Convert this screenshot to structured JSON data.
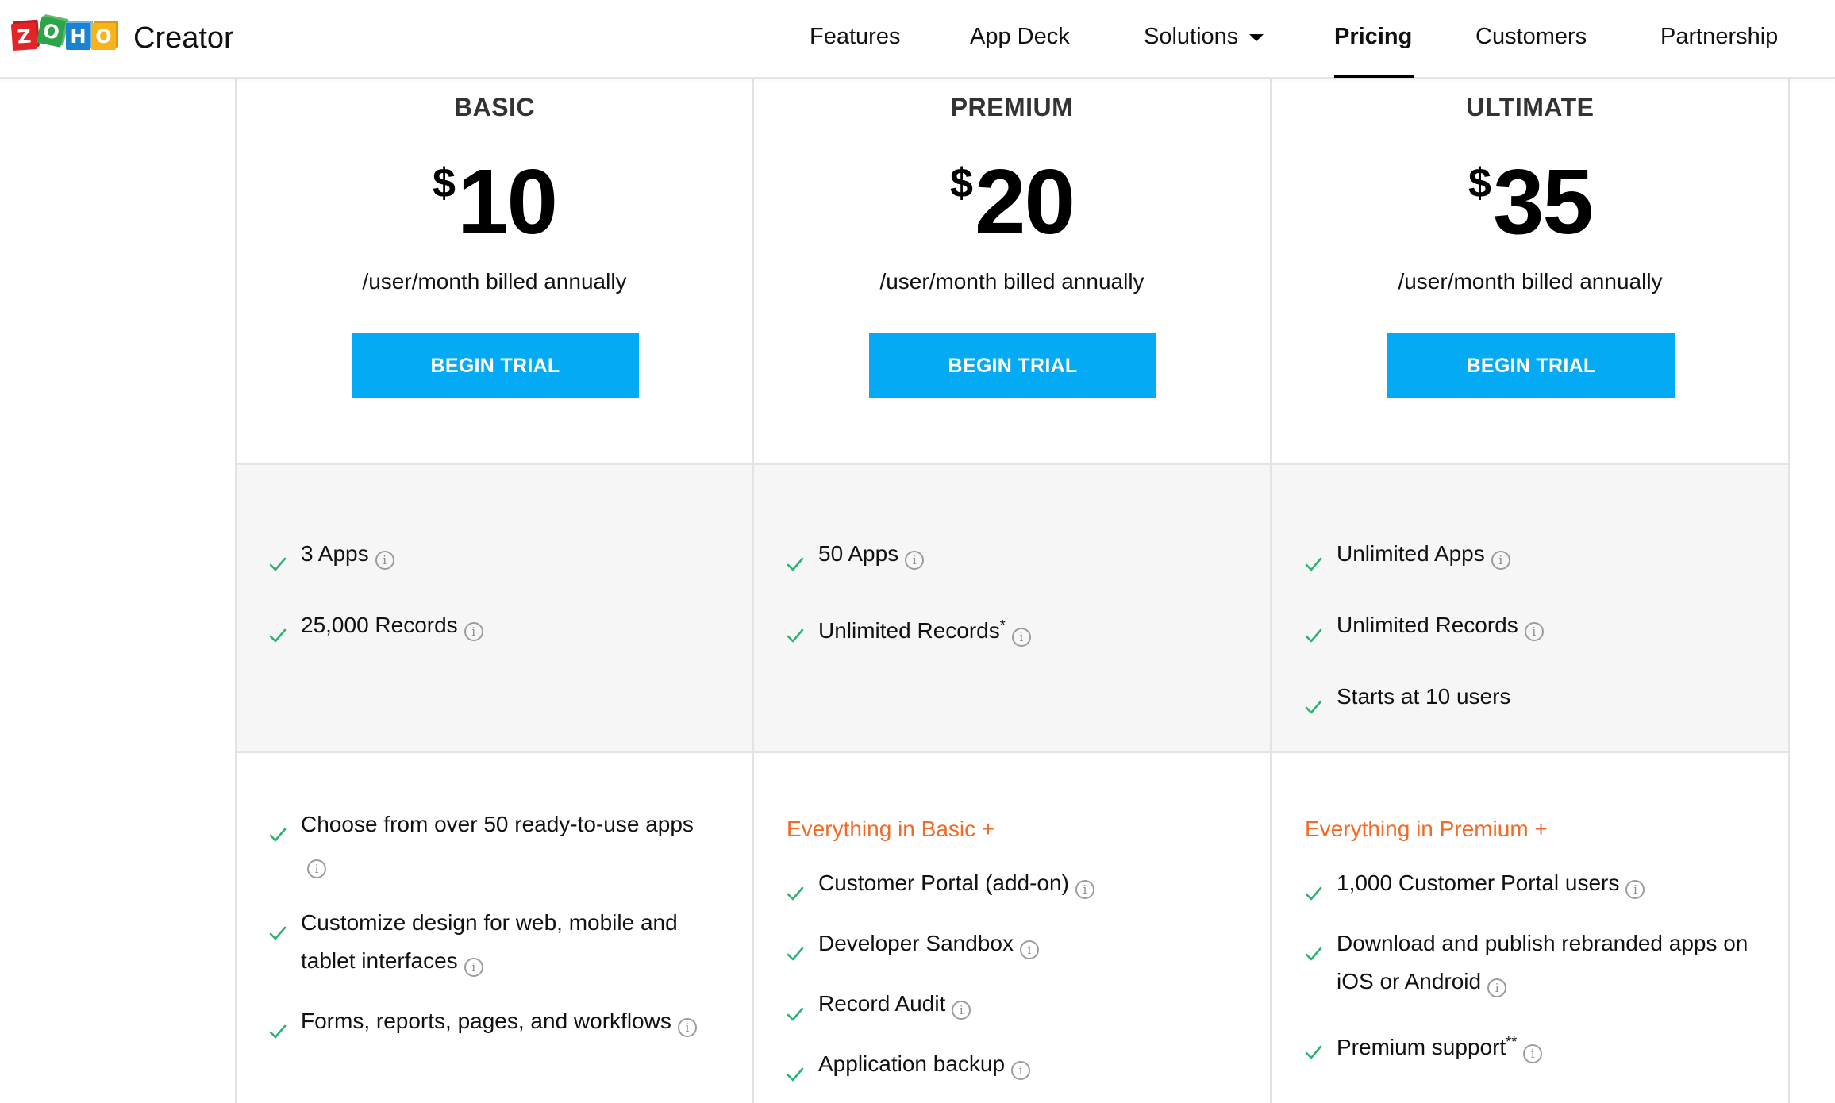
{
  "header": {
    "logo_letters": [
      "Z",
      "O",
      "H",
      "O"
    ],
    "logo_icon": "zoho-logo-icon",
    "brand_name": "Creator",
    "nav": [
      {
        "label": "Features",
        "active": false
      },
      {
        "label": "App Deck",
        "active": false
      },
      {
        "label": "Solutions",
        "active": false,
        "has_dropdown": true,
        "dropdown_icon": "caret-down-icon"
      },
      {
        "label": "Pricing",
        "active": true
      },
      {
        "label": "Customers",
        "active": false
      },
      {
        "label": "Partnership",
        "active": false
      }
    ]
  },
  "colors": {
    "accent_button": "#05aaf5",
    "check_green": "#2db36f",
    "highlight_orange": "#f26a25",
    "section_grey": "#f6f6f6"
  },
  "plans": [
    {
      "name": "BASIC",
      "currency": "$",
      "price": "10",
      "billing": "/user/month billed annually",
      "cta": "BEGIN TRIAL",
      "limits": [
        {
          "text": "3 Apps",
          "info": true
        },
        {
          "text": "25,000 Records",
          "info": true
        }
      ],
      "includes_label": "",
      "features": [
        {
          "text": "Choose from over 50 ready-to-use apps",
          "info": true
        },
        {
          "text": "Customize design for web, mobile and tablet interfaces",
          "info": true
        },
        {
          "text": "Forms, reports, pages, and workflows",
          "info": true
        }
      ]
    },
    {
      "name": "PREMIUM",
      "currency": "$",
      "price": "20",
      "billing": "/user/month billed annually",
      "cta": "BEGIN TRIAL",
      "limits": [
        {
          "text": "50 Apps",
          "info": true
        },
        {
          "text": "Unlimited Records",
          "sup": "*",
          "info": true
        }
      ],
      "includes_label": "Everything in Basic +",
      "features": [
        {
          "text": "Customer Portal (add-on)",
          "info": true
        },
        {
          "text": "Developer Sandbox",
          "info": true
        },
        {
          "text": "Record Audit",
          "info": true
        },
        {
          "text": "Application backup",
          "info": true
        }
      ]
    },
    {
      "name": "ULTIMATE",
      "currency": "$",
      "price": "35",
      "billing": "/user/month billed annually",
      "cta": "BEGIN TRIAL",
      "limits": [
        {
          "text": "Unlimited Apps",
          "info": true
        },
        {
          "text": "Unlimited Records",
          "info": true
        },
        {
          "text": "Starts at 10 users",
          "info": false
        }
      ],
      "includes_label": "Everything in Premium +",
      "features": [
        {
          "text": "1,000 Customer Portal users",
          "info": true
        },
        {
          "text": "Download and publish rebranded apps on iOS or Android",
          "info": true
        },
        {
          "text": "Premium support",
          "sup": "**",
          "info": true
        }
      ]
    }
  ],
  "icons": {
    "check": "check-icon",
    "info": "info-icon",
    "info_glyph": "i"
  }
}
